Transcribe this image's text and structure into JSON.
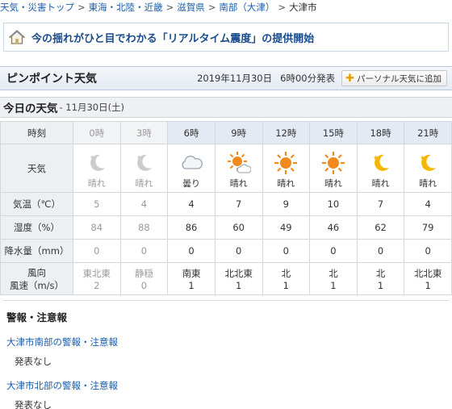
{
  "breadcrumb": {
    "items": [
      "天気・災害トップ",
      "東海・北陸・近畿",
      "滋賀県",
      "南部（大津）"
    ],
    "separator": ">",
    "current": "大津市"
  },
  "notice": {
    "text": "今の揺れがひと目でわかる「リアルタイム震度」の提供開始",
    "icon": "house-icon"
  },
  "pinpoint": {
    "title": "ピンポイント天気",
    "date": "2019年11月30日",
    "time": "6時00分発表",
    "personal_button": "パーソナル天気に追加"
  },
  "today": {
    "title": "今日の天気",
    "date": "- 11月30日(土)"
  },
  "table": {
    "labels": {
      "time": "時刻",
      "weather": "天気",
      "temp": "気温（℃）",
      "humidity": "湿度（%）",
      "precip": "降水量（mm）",
      "wind_dir": "風向",
      "wind_speed": "風速（m/s）"
    },
    "columns": [
      {
        "time": "0時",
        "weather": "晴れ",
        "icon": "moon-clear-icon",
        "temp": "5",
        "humidity": "84",
        "precip": "0",
        "wind_dir": "東北東",
        "wind_speed": "2",
        "past": true
      },
      {
        "time": "3時",
        "weather": "晴れ",
        "icon": "moon-clear-icon",
        "temp": "4",
        "humidity": "88",
        "precip": "0",
        "wind_dir": "静穏",
        "wind_speed": "0",
        "past": true
      },
      {
        "time": "6時",
        "weather": "曇り",
        "icon": "cloud-icon",
        "temp": "4",
        "humidity": "86",
        "precip": "0",
        "wind_dir": "南東",
        "wind_speed": "1",
        "past": false
      },
      {
        "time": "9時",
        "weather": "晴れ",
        "icon": "sun-cloud-icon",
        "temp": "7",
        "humidity": "60",
        "precip": "0",
        "wind_dir": "北北東",
        "wind_speed": "1",
        "past": false
      },
      {
        "time": "12時",
        "weather": "晴れ",
        "icon": "sun-icon",
        "temp": "9",
        "humidity": "49",
        "precip": "0",
        "wind_dir": "北",
        "wind_speed": "1",
        "past": false
      },
      {
        "time": "15時",
        "weather": "晴れ",
        "icon": "sun-icon",
        "temp": "10",
        "humidity": "46",
        "precip": "0",
        "wind_dir": "北",
        "wind_speed": "1",
        "past": false
      },
      {
        "time": "18時",
        "weather": "晴れ",
        "icon": "moon-clear-icon",
        "temp": "7",
        "humidity": "62",
        "precip": "0",
        "wind_dir": "北",
        "wind_speed": "1",
        "past": false
      },
      {
        "time": "21時",
        "weather": "晴れ",
        "icon": "moon-clear-icon",
        "temp": "4",
        "humidity": "79",
        "precip": "0",
        "wind_dir": "北北東",
        "wind_speed": "1",
        "past": false
      }
    ]
  },
  "warnings": {
    "title": "警報・注意報",
    "items": [
      {
        "area": "大津市南部の警報・注意報",
        "status": "発表なし"
      },
      {
        "area": "大津市北部の警報・注意報",
        "status": "発表なし"
      }
    ]
  },
  "colors": {
    "link": "#1a5dab",
    "sun": "#f08a1c",
    "moon": "#f5b800",
    "past_moon": "#cccccc"
  }
}
